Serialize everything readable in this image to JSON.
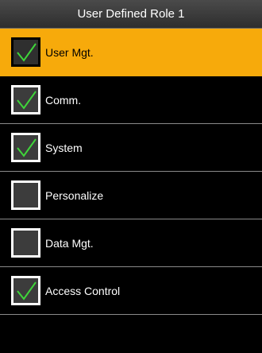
{
  "title": "User Defined Role 1",
  "colors": {
    "highlight": "#f7aa0b",
    "check": "#3fd53a",
    "background": "#000000"
  },
  "items": [
    {
      "label": "User Mgt.",
      "checked": true,
      "selected": true
    },
    {
      "label": "Comm.",
      "checked": true,
      "selected": false
    },
    {
      "label": "System",
      "checked": true,
      "selected": false
    },
    {
      "label": "Personalize",
      "checked": false,
      "selected": false
    },
    {
      "label": "Data Mgt.",
      "checked": false,
      "selected": false
    },
    {
      "label": "Access Control",
      "checked": true,
      "selected": false
    }
  ]
}
